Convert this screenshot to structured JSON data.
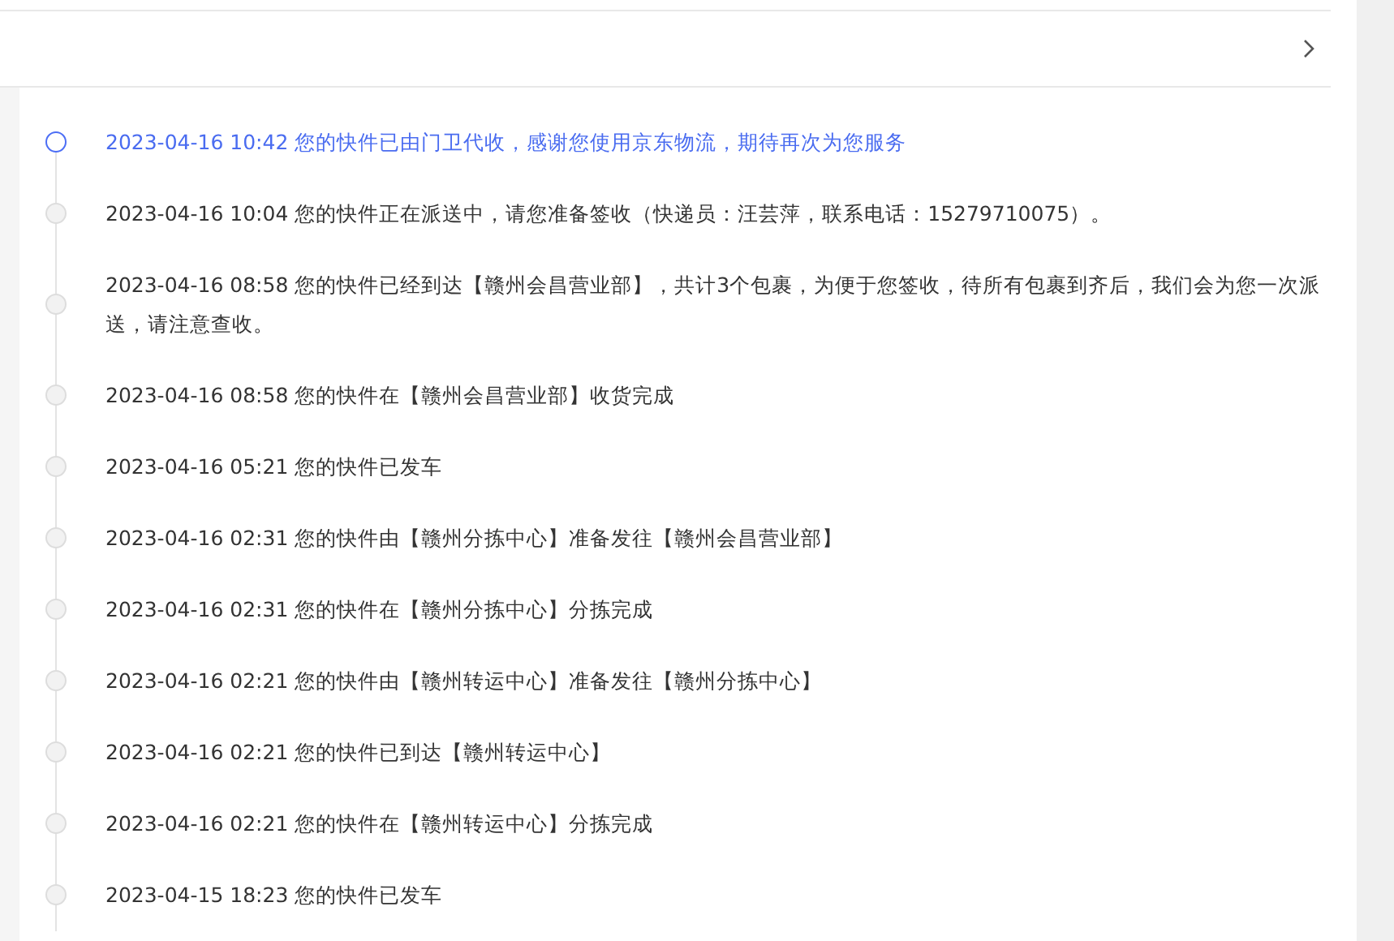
{
  "timeline": [
    {
      "text": "2023-04-16 10:42 您的快件已由门卫代收，感谢您使用京东物流，期待再次为您服务",
      "current": true
    },
    {
      "text": "2023-04-16 10:04 您的快件正在派送中，请您准备签收（快递员：汪芸萍，联系电话：15279710075）。",
      "current": false
    },
    {
      "text": "2023-04-16 08:58 您的快件已经到达【赣州会昌营业部】，共计3个包裹，为便于您签收，待所有包裹到齐后，我们会为您一次派送，请注意查收。",
      "current": false
    },
    {
      "text": "2023-04-16 08:58 您的快件在【赣州会昌营业部】收货完成",
      "current": false
    },
    {
      "text": "2023-04-16 05:21 您的快件已发车",
      "current": false
    },
    {
      "text": "2023-04-16 02:31 您的快件由【赣州分拣中心】准备发往【赣州会昌营业部】",
      "current": false
    },
    {
      "text": "2023-04-16 02:31 您的快件在【赣州分拣中心】分拣完成",
      "current": false
    },
    {
      "text": "2023-04-16 02:21 您的快件由【赣州转运中心】准备发往【赣州分拣中心】",
      "current": false
    },
    {
      "text": "2023-04-16 02:21 您的快件已到达【赣州转运中心】",
      "current": false
    },
    {
      "text": "2023-04-16 02:21 您的快件在【赣州转运中心】分拣完成",
      "current": false
    },
    {
      "text": "2023-04-15 18:23 您的快件已发车",
      "current": false
    }
  ]
}
